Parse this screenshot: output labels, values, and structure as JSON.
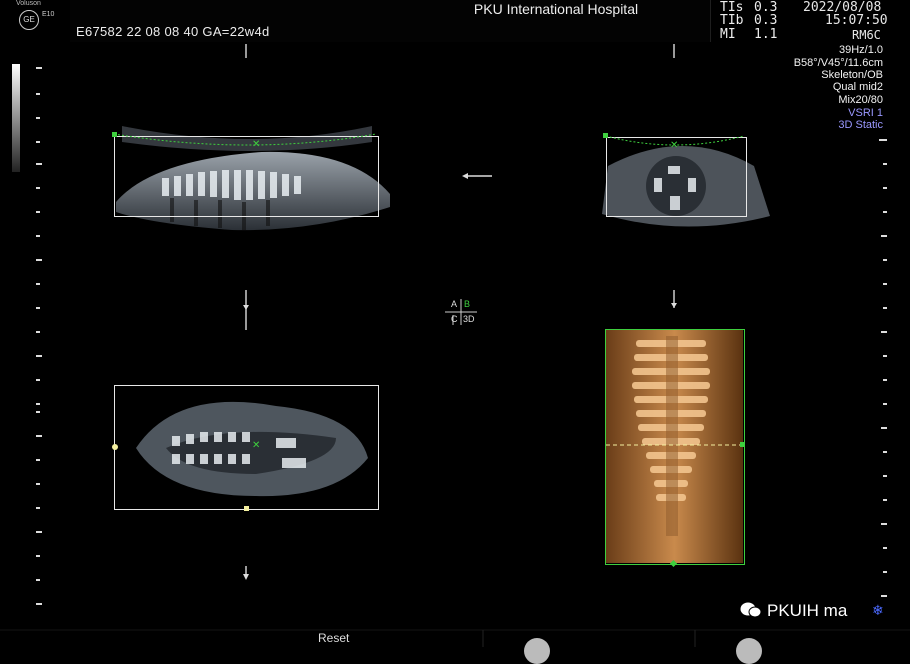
{
  "header": {
    "brand_small": "Voluson",
    "brand_logo": "GE",
    "model": "E10",
    "patient_line": "E67582 22 08 08 40  GA=22w4d",
    "hospital": "PKU International Hospital",
    "indices": [
      {
        "label": "TIs",
        "value": "0.3"
      },
      {
        "label": "TIb",
        "value": "0.3"
      },
      {
        "label": "MI",
        "value": "1.1"
      }
    ],
    "date": "2022/08/08",
    "time": "15:07:50",
    "probe": "RM6C"
  },
  "right_info": {
    "lines": [
      "39Hz/1.0",
      "B58°/V45°/11.6cm",
      "Skeleton/OB",
      "Qual mid2",
      "Mix20/80"
    ],
    "mode_lines": [
      "VSRI 1",
      "3D Static"
    ]
  },
  "quad_marker": {
    "a": "A",
    "b": "B",
    "c": "C",
    "d": "3D"
  },
  "footer": {
    "reset_label": "Reset",
    "watermark": "PKUIH ma"
  },
  "colors": {
    "marker_green": "#3ecf3e",
    "render_orange": "#c07a3a",
    "mode_blue": "#9a98ff"
  },
  "icons": [
    "ge-logo-icon",
    "wechat-icon",
    "snowflake-icon",
    "arrow-left-icon",
    "arrow-down-icon"
  ]
}
